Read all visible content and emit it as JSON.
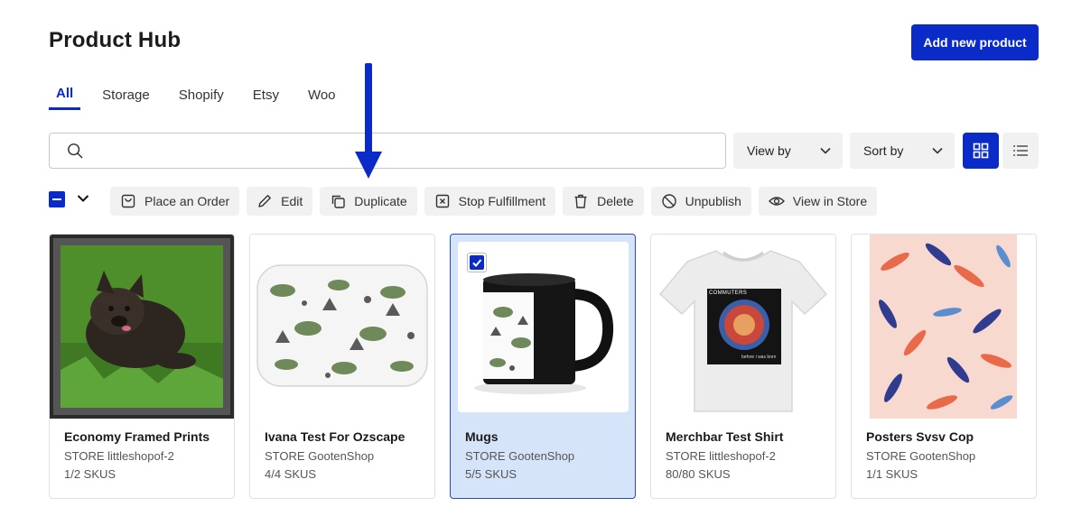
{
  "header": {
    "title": "Product Hub",
    "add_button": "Add new product"
  },
  "tabs": [
    {
      "label": "All",
      "active": true
    },
    {
      "label": "Storage",
      "active": false
    },
    {
      "label": "Shopify",
      "active": false
    },
    {
      "label": "Etsy",
      "active": false
    },
    {
      "label": "Woo",
      "active": false
    }
  ],
  "search": {
    "value": "",
    "placeholder": ""
  },
  "filters": {
    "view_by": "View by",
    "sort_by": "Sort by",
    "view_mode": "grid"
  },
  "bulk_actions": [
    {
      "label": "Place an Order",
      "icon": "shopping-bag-icon"
    },
    {
      "label": "Edit",
      "icon": "pencil-icon"
    },
    {
      "label": "Duplicate",
      "icon": "copy-icon"
    },
    {
      "label": "Stop Fulfillment",
      "icon": "x-square-icon"
    },
    {
      "label": "Delete",
      "icon": "trash-icon"
    },
    {
      "label": "Unpublish",
      "icon": "ban-icon"
    },
    {
      "label": "View in Store",
      "icon": "eye-icon"
    }
  ],
  "products": [
    {
      "name": "Economy Framed Prints",
      "store": "STORE littleshopof-2",
      "skus": "1/2 SKUS",
      "selected": false
    },
    {
      "name": "Ivana Test For Ozscape",
      "store": "STORE GootenShop",
      "skus": "4/4 SKUS",
      "selected": false
    },
    {
      "name": "Mugs",
      "store": "STORE GootenShop",
      "skus": "5/5 SKUS",
      "selected": true
    },
    {
      "name": "Merchbar Test Shirt",
      "store": "STORE littleshopof-2",
      "skus": "80/80 SKUS",
      "selected": false,
      "print": {
        "band": "COMMUTERS",
        "caption": "before i was born"
      }
    },
    {
      "name": "Posters Svsv Cop",
      "store": "STORE GootenShop",
      "skus": "1/1 SKUS",
      "selected": false
    }
  ],
  "colors": {
    "accent": "#0a2bc7",
    "selected_card": "#d6e4fa",
    "annotation_arrow": "#0a2bc7"
  }
}
